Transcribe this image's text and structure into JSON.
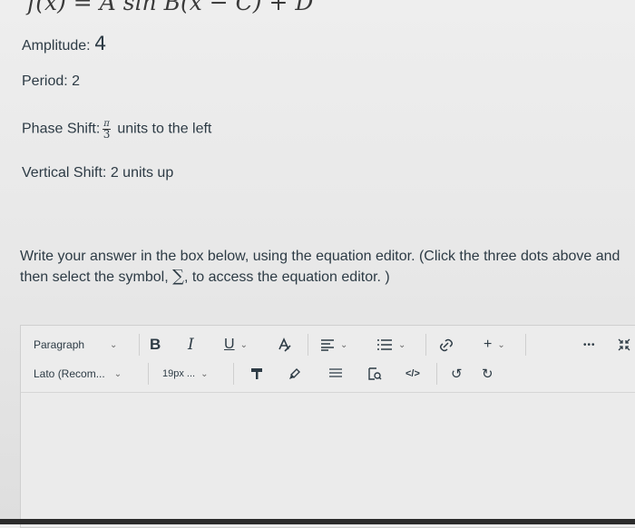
{
  "formula": "f(x) = A sin B(x − C) + D",
  "amplitude": {
    "label": "Amplitude:",
    "value": "4"
  },
  "period": {
    "label": "Period:",
    "value": "2"
  },
  "phase_shift": {
    "label": "Phase Shift:",
    "numerator": "π",
    "denominator": "3",
    "suffix": "units to the left"
  },
  "vertical_shift": {
    "label": "Vertical Shift:",
    "value": "2 units up"
  },
  "instructions": {
    "before_symbol": "Write your answer in the box below, using the equation editor. (Click the three dots above and then select the symbol,",
    "symbol": "∑",
    "after_symbol": ", to access the equation editor. )"
  },
  "toolbar": {
    "paragraph_select": "Paragraph",
    "font_select": "Lato (Recom...",
    "size_select": "19px ...",
    "bold": "B",
    "italic": "I",
    "underline": "U",
    "more": "•••"
  }
}
